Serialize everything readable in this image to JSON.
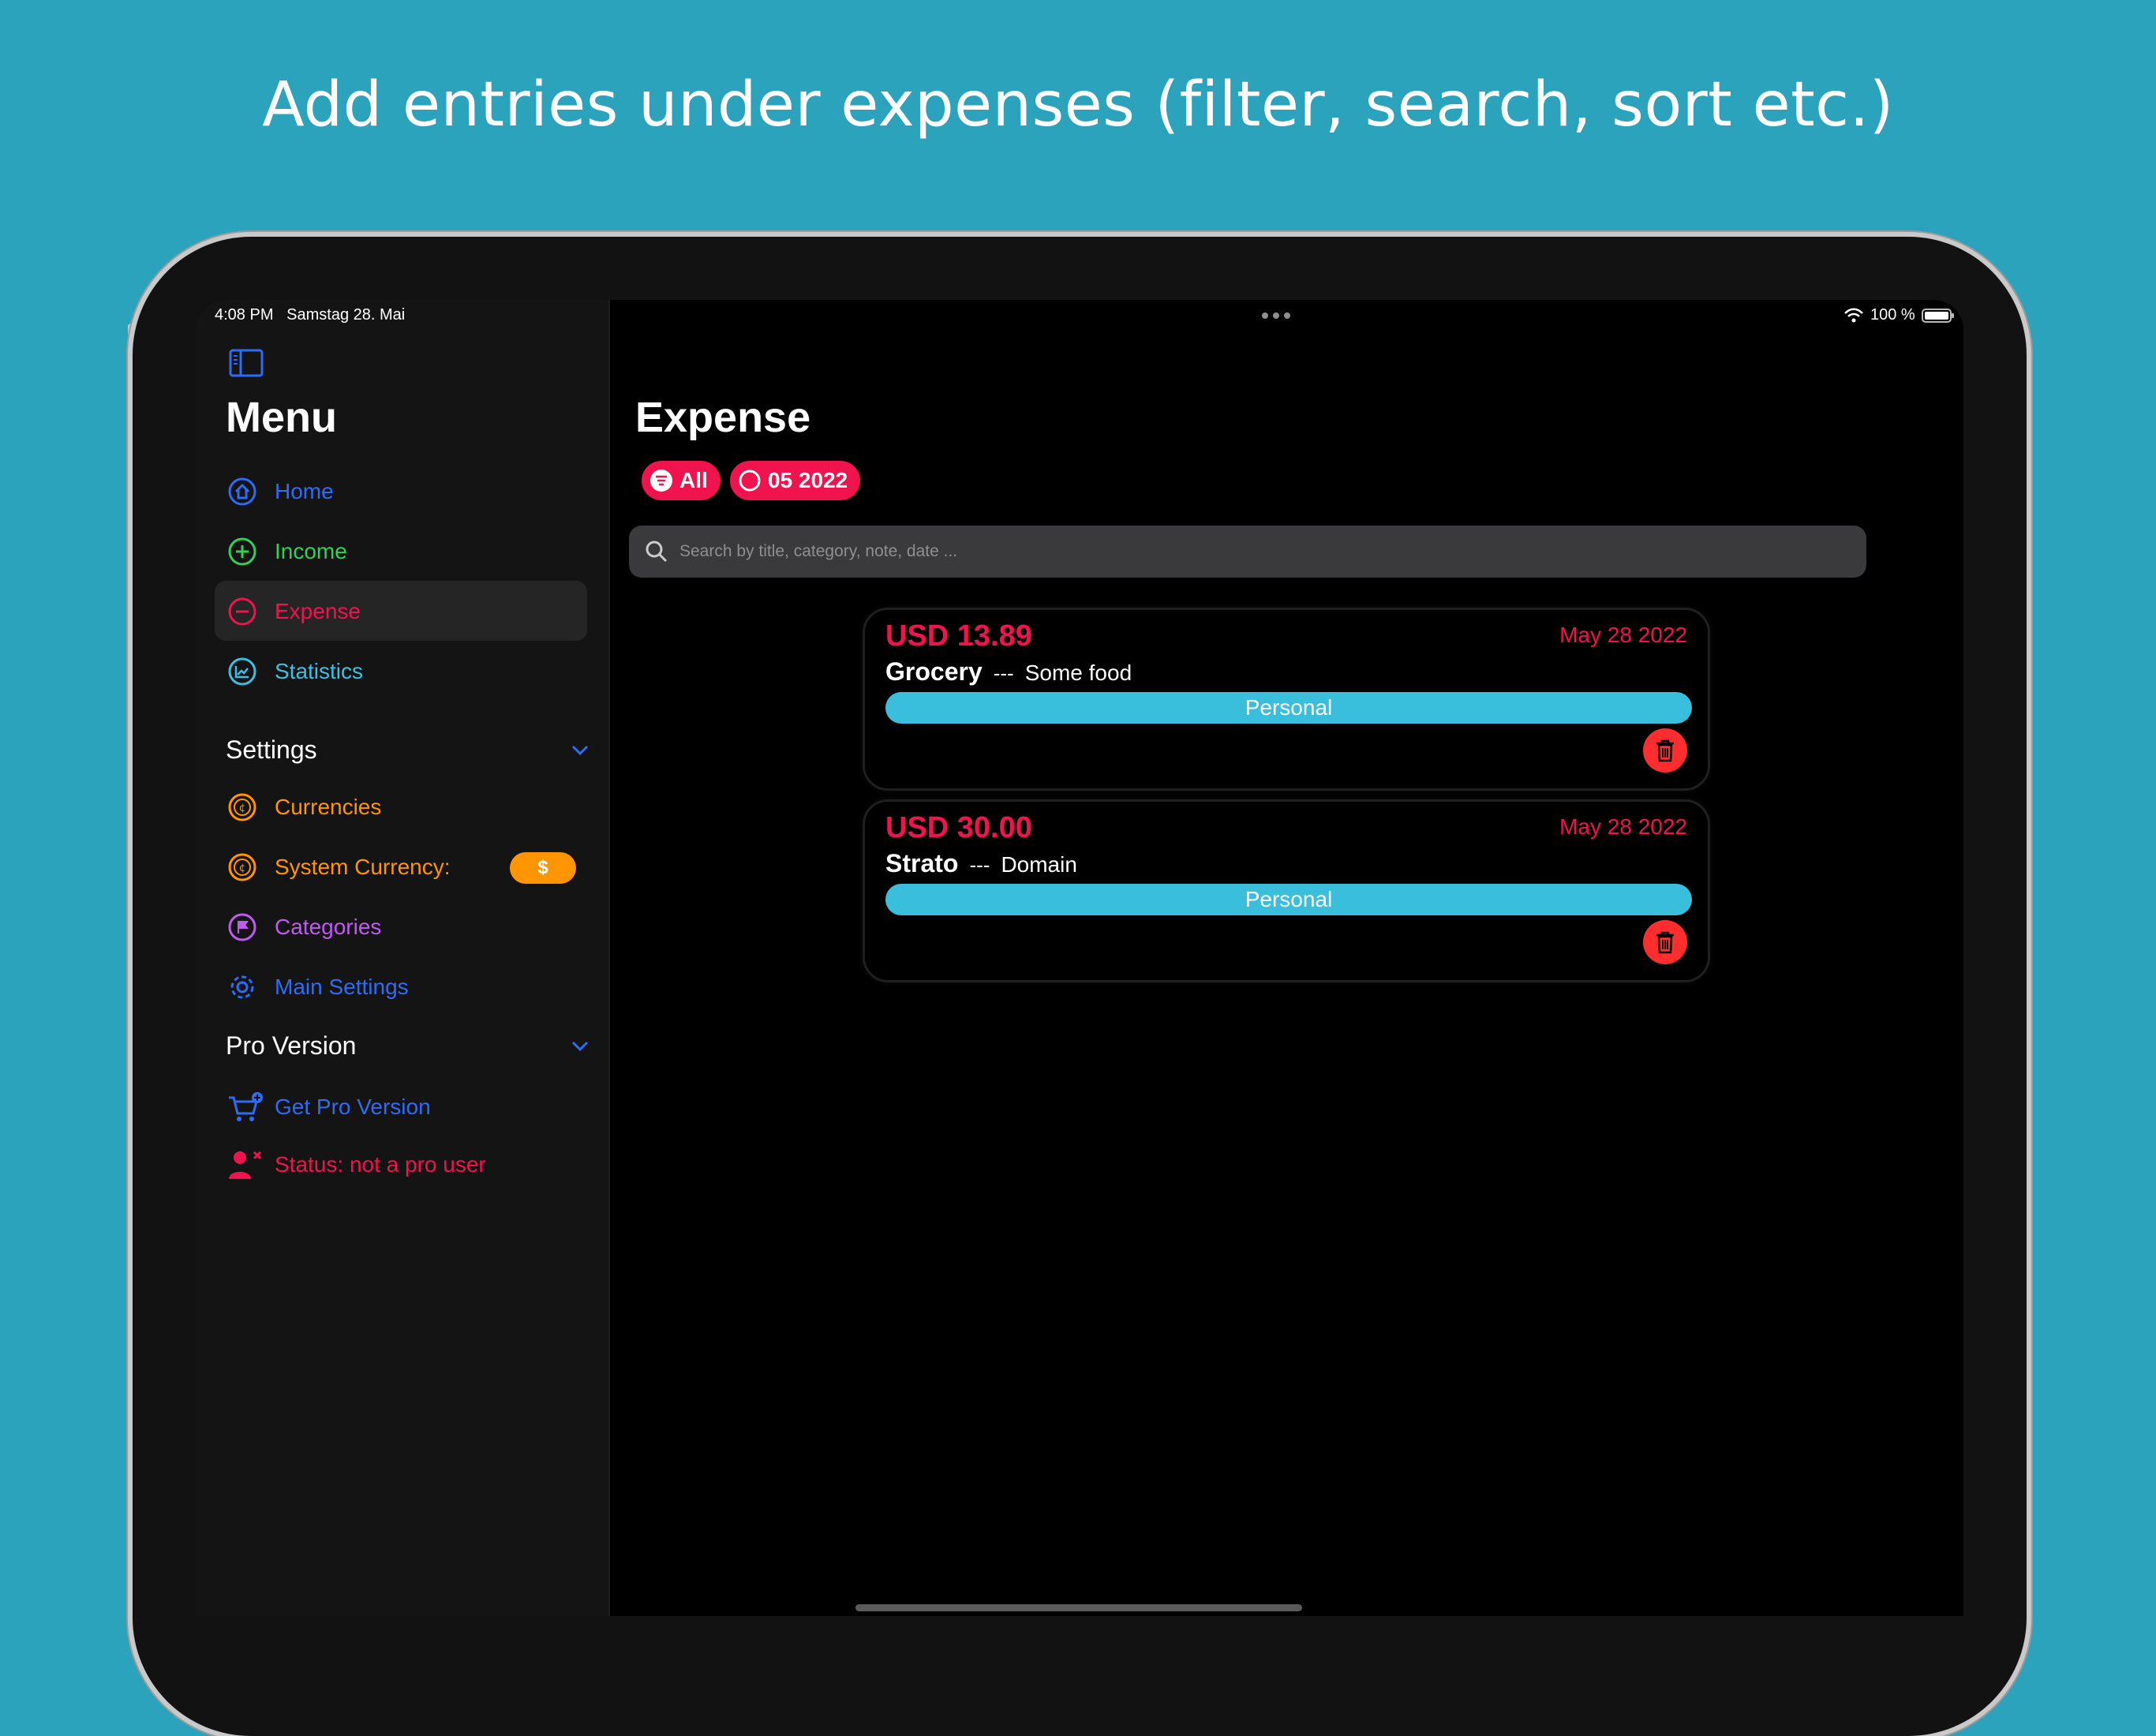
{
  "headline": "Add entries under expenses (filter, search, sort etc.)",
  "status_bar": {
    "time": "4:08 PM",
    "date": "Samstag 28. Mai",
    "battery": "100 %"
  },
  "sidebar": {
    "title": "Menu",
    "items": [
      {
        "label": "Home",
        "color": "#2d6cf6",
        "icon": "house-icon"
      },
      {
        "label": "Income",
        "color": "#2fd158",
        "icon": "plus-circle-icon"
      },
      {
        "label": "Expense",
        "color": "#f0134d",
        "icon": "minus-circle-icon"
      },
      {
        "label": "Statistics",
        "color": "#3fbfe0",
        "icon": "chart-icon"
      }
    ],
    "settings": {
      "title": "Settings",
      "items": [
        {
          "label": "Currencies",
          "color": "#ff9500",
          "icon": "currency-icon"
        },
        {
          "label": "System Currency:",
          "color": "#ff9500",
          "icon": "currency-icon",
          "badge": "$"
        },
        {
          "label": "Categories",
          "color": "#bf5af2",
          "icon": "flag-icon"
        },
        {
          "label": "Main Settings",
          "color": "#2d6cf6",
          "icon": "gear-icon"
        }
      ]
    },
    "pro": {
      "title": "Pro Version",
      "items": [
        {
          "label": "Get Pro Version",
          "color": "#2d6cf6",
          "icon": "cart-icon"
        },
        {
          "label": "Status: not a pro user",
          "color": "#f0134d",
          "icon": "person-x-icon"
        }
      ]
    }
  },
  "main": {
    "title": "Expense",
    "chips": [
      {
        "label": "All",
        "icon": "filter-icon"
      },
      {
        "label": "05 2022",
        "icon": "circle-icon"
      }
    ],
    "search_placeholder": "Search by title, category, note, date ...",
    "entries": [
      {
        "amount": "USD 13.89",
        "date": "May 28 2022",
        "title": "Grocery",
        "separator": "---",
        "note": "Some food",
        "category": "Personal"
      },
      {
        "amount": "USD 30.00",
        "date": "May 28 2022",
        "title": "Strato",
        "separator": "---",
        "note": "Domain",
        "category": "Personal"
      }
    ]
  },
  "colors": {
    "accent": "#f0134d",
    "category": "#39bfdc",
    "background": "#2ba3bd"
  }
}
